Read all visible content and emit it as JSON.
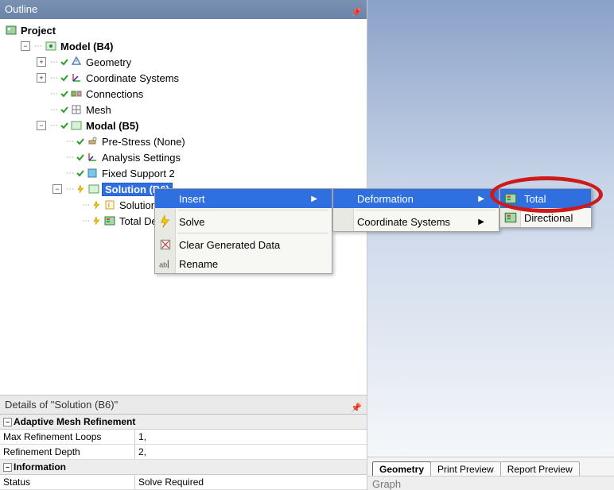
{
  "outline": {
    "title": "Outline",
    "project_label": "Project",
    "model_label": "Model (B4)",
    "geometry_label": "Geometry",
    "coord_systems_label": "Coordinate Systems",
    "connections_label": "Connections",
    "mesh_label": "Mesh",
    "modal_label": "Modal (B5)",
    "prestress_label": "Pre-Stress (None)",
    "analysis_settings_label": "Analysis Settings",
    "fixed_support_label": "Fixed Support 2",
    "solution_label": "Solution (B6)",
    "solution_info_label": "Solution ",
    "total_def_label": "Total De"
  },
  "context_menu": {
    "insert": "Insert",
    "solve": "Solve",
    "clear": "Clear Generated Data",
    "rename": "Rename"
  },
  "submenu1": {
    "deformation": "Deformation",
    "coord_systems": "Coordinate Systems"
  },
  "submenu2": {
    "total": "Total",
    "directional": "Directional"
  },
  "details": {
    "title": "Details of \"Solution (B6)\"",
    "group1": "Adaptive Mesh Refinement",
    "max_loops_k": "Max Refinement Loops",
    "max_loops_v": "1,",
    "ref_depth_k": "Refinement Depth",
    "ref_depth_v": "2,",
    "group2": "Information",
    "status_k": "Status",
    "status_v": "Solve Required"
  },
  "tabs": {
    "geometry": "Geometry",
    "print_preview": "Print Preview",
    "report_preview": "Report Preview"
  },
  "graph_label": "Graph"
}
